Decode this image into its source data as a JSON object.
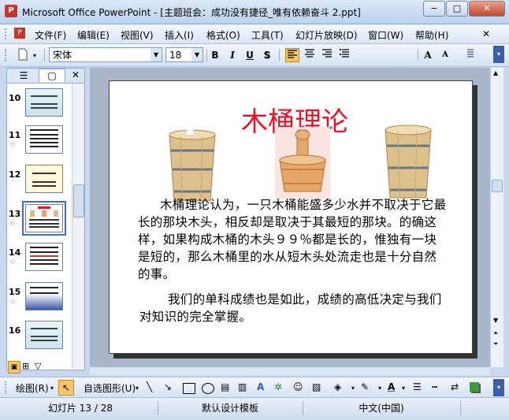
{
  "window": {
    "title": "Microsoft Office PowerPoint - [主题班会：成功没有捷径_唯有依赖奋斗 2.ppt]",
    "app_icon": "powerpoint-icon",
    "min": "−",
    "max": "□",
    "close": "✕"
  },
  "menu": {
    "items": [
      "文件(F)",
      "编辑(E)",
      "视图(V)",
      "插入(I)",
      "格式(O)",
      "工具(T)",
      "幻灯片放映(D)",
      "窗口(W)",
      "帮助(H)"
    ],
    "close": "✕"
  },
  "toolbar": {
    "font_name": "宋体",
    "font_size": "18",
    "bold": "B",
    "italic": "I",
    "underline": "U",
    "shadow": "S",
    "grow": "A",
    "shrink": "A"
  },
  "thumbs": [
    {
      "num": "10",
      "star": ""
    },
    {
      "num": "11",
      "star": "☆"
    },
    {
      "num": "12",
      "star": ""
    },
    {
      "num": "13",
      "star": "☆"
    },
    {
      "num": "14",
      "star": "☆"
    },
    {
      "num": "15",
      "star": "☆"
    },
    {
      "num": "16",
      "star": ""
    }
  ],
  "slide": {
    "title": "木桶理论",
    "body1": "木桶理论认为，一只木桶能盛多少水并不取决于它最长的那块木头，相反却是取决于其最短的那块。的确这样，如果构成木桶的木头９９％都是长的，惟独有一块是短的，那么木桶里的水从短木头处流走也是十分自然的事。",
    "body2": "我们的单科成绩也是如此，成绩的高低决定与我们对知识的完全掌握。"
  },
  "drawing": {
    "draw": "绘图(R)",
    "autoshapes": "自选图形(U)"
  },
  "status": {
    "slide_count": "幻灯片 13 / 28",
    "template": "默认设计模板",
    "language": "中文(中国)"
  },
  "colors": {
    "title_red": "#e8122a",
    "wood": "#dcc18c",
    "selection_blue": "#3b6cc6"
  }
}
